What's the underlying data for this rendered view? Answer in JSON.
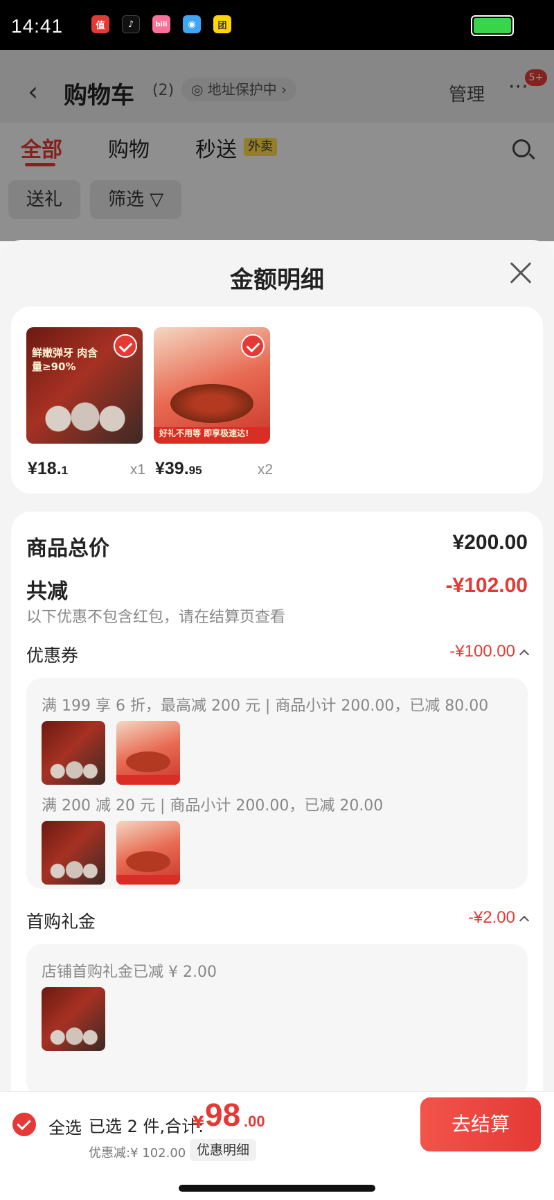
{
  "status_bar": {
    "time": "14:41",
    "apps": [
      {
        "label": "值",
        "color": "#e53935",
        "icon": "zhi-app-icon"
      },
      {
        "label": "♪",
        "color": "#111111",
        "icon": "tiktok-app-icon"
      },
      {
        "label": "bili",
        "color": "#fb7299",
        "icon": "bilibili-app-icon"
      },
      {
        "label": "◉",
        "color": "#3ea7f5",
        "icon": "qq-app-icon"
      },
      {
        "label": "团",
        "color": "#ffd400",
        "icon": "tuanlian-app-icon"
      }
    ]
  },
  "background_page": {
    "back": "‹",
    "title": "购物车",
    "count": "(2)",
    "address_badge": "◎ 地址保护中 ›",
    "manage": "管理",
    "more": "···",
    "badge": "5+",
    "tabs": [
      "全部",
      "购物",
      "秒送"
    ],
    "tab_tag": "外卖",
    "chips": [
      "送礼",
      "筛选 ▽"
    ]
  },
  "sheet": {
    "title": "金额明细",
    "products": [
      {
        "price_int": "¥18.",
        "price_dec": "1",
        "qty": "x1",
        "img_text": "鲜嫩弹牙 肉含量≥90%"
      },
      {
        "price_int": "¥39.",
        "price_dec": "95",
        "qty": "x2",
        "img_text": "好礼不用等 即享极速达!"
      }
    ],
    "total_label": "商品总价",
    "total_value": "¥200.00",
    "discount_label": "共减",
    "discount_value": "-¥102.00",
    "discount_note": "以下优惠不包含红包，请在结算页查看",
    "coupon_label": "优惠券",
    "coupon_value": "-¥100.00",
    "coupon_rules": [
      "满 199 享 6 折，最高减 200 元 | 商品小计 200.00，已减 80.00",
      "满 200 减 20 元 | 商品小计 200.00，已减 20.00"
    ],
    "gift_label": "首购礼金",
    "gift_value": "-¥2.00",
    "gift_rule": "店铺首购礼金已减 ¥ 2.00"
  },
  "bottom_bar": {
    "select_all": "全选",
    "summary": "已选 2 件,合计:",
    "total_currency": "¥",
    "total_int": "98",
    "total_dec": ".00",
    "discount_line": "优惠减:¥ 102.00",
    "detail_link": "优惠明细",
    "checkout": "去结算"
  }
}
